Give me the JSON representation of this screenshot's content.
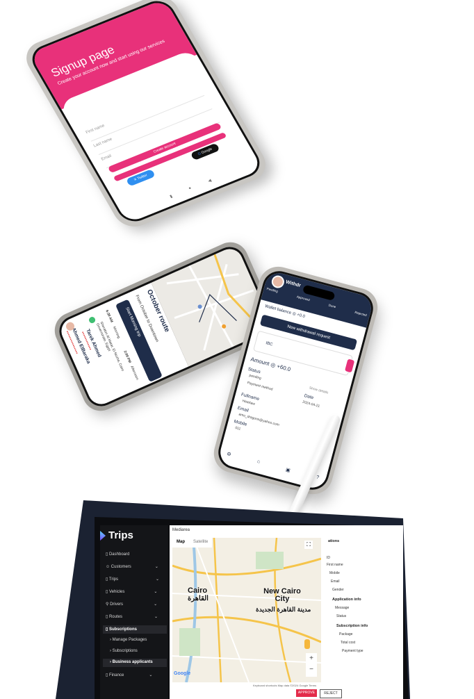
{
  "signup": {
    "title": "Signup page",
    "subtitle": "Create your account now and start using our services",
    "first_name_placeholder": "First name",
    "last_name_placeholder": "Last name",
    "email_placeholder": "Email",
    "create_button": "Create account",
    "continue_text": "Continue with social media",
    "twitter_button": "Twitter",
    "google_button": "Google",
    "accent_color": "#e8317a"
  },
  "route": {
    "title": "October route",
    "subtitle": "From October to Downtown",
    "start_button": "Start Morning trip",
    "time_morning": "6:30 AM",
    "label_morning": "Morning",
    "time_afternoon": "2:00 PM",
    "label_afternoon": "Afternoon",
    "stop_address": "Sheraton Al Matar, El Nozha, Cairo Governorate, Egypt",
    "rider_1": "Tarek Ahmed",
    "rider_2": "Ahmed ElBaraka"
  },
  "wallet": {
    "header_title": "Withdr",
    "tabs": [
      "Pending",
      "Approved",
      "Done",
      "Rejected"
    ],
    "balance_label": "Wallet balance",
    "balance_value": "+0.0",
    "new_request_button": "New withdrawal request",
    "card_text": "IBC",
    "amount_label": "Amount",
    "amount_value": "+60.0",
    "status_label": "Status",
    "status_value": "pending",
    "show_details": "Show details",
    "payment_method": "Payment method",
    "date_label": "Date",
    "date_value": "2024-04-21",
    "fullname_label": "Fullname",
    "fullname_value": "Heartaw",
    "email_label": "Email",
    "email_value": "amo_dragons@yahoo.com",
    "mobile_label": "Mobile",
    "mobile_value": "011"
  },
  "admin": {
    "brand": "Trips",
    "nav": [
      "Dashboard",
      "Customers",
      "Trips",
      "Vehicles",
      "Drivers",
      "Routes",
      "Subscriptions",
      "Manage Packages",
      "Subscriptions",
      "Business applicants",
      "Finance"
    ],
    "breadcrumb": "Mediarea",
    "map_tabs": [
      "Map",
      "Satellite"
    ],
    "city_1": "Cairo",
    "city_1_ar": "القاهرة",
    "city_2": "New Cairo City",
    "city_2_ar": "مدينة القاهرة الجديدة",
    "map_footer": "Keyboard shortcuts   Map data ©2024 Google   Terms",
    "google_label": "Google",
    "panel_heading": "ations",
    "panel_labels": [
      "ID",
      "First name",
      "Mobile",
      "Email",
      "Gender"
    ],
    "app_info_heading": "Application info",
    "app_info_labels": [
      "Message",
      "Status"
    ],
    "sub_info_heading": "Subscription info",
    "sub_info_labels": [
      "Package",
      "Total cost",
      "Payment type"
    ],
    "approve_button": "APPROVE",
    "reject_button": "REJECT"
  }
}
